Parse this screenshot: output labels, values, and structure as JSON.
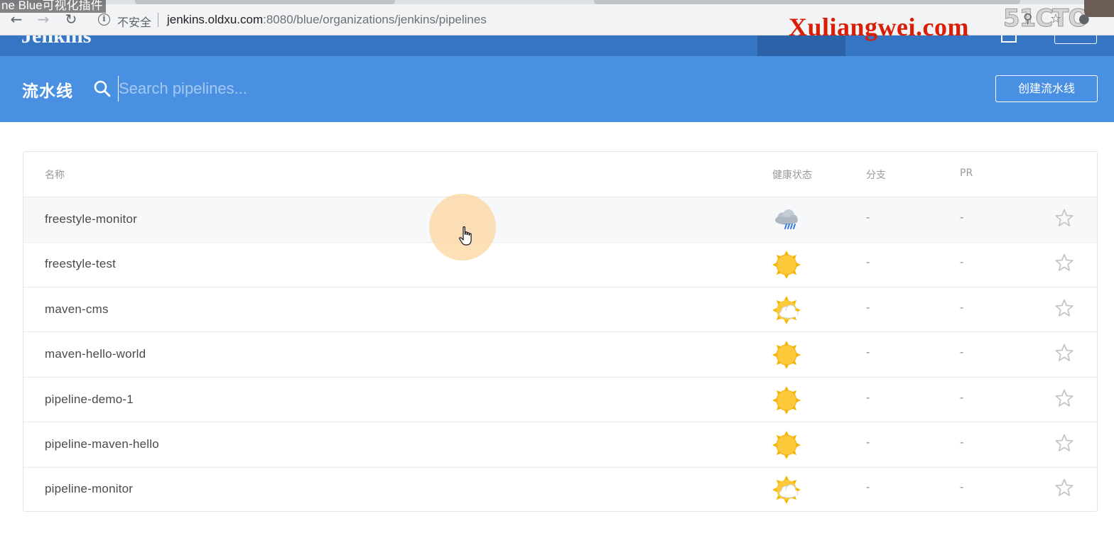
{
  "video": {
    "title_overlay": "ne Blue可视化插件"
  },
  "browser": {
    "back_icon": "arrow-back-icon",
    "forward_icon": "arrow-forward-icon",
    "reload_icon": "reload-icon",
    "security_label": "不安全",
    "url_host": "jenkins.oldxu.com",
    "url_rest": ":8080/blue/organizations/jenkins/pipelines"
  },
  "watermark": {
    "text": "Xuliangwei.com",
    "brand": "51CTO",
    "color": "#d81e06"
  },
  "jenkins": {
    "logo": "Jenkins"
  },
  "pipelines_bar": {
    "title": "流水线",
    "search_placeholder": "Search pipelines...",
    "create_button": "创建流水线",
    "accent": "#4a90e2"
  },
  "table": {
    "headers": {
      "name": "名称",
      "health": "健康状态",
      "branches": "分支",
      "pr": "PR"
    },
    "rows": [
      {
        "name": "freestyle-monitor",
        "health": "rain",
        "branches": "-",
        "pr": "-"
      },
      {
        "name": "freestyle-test",
        "health": "sunny",
        "branches": "-",
        "pr": "-"
      },
      {
        "name": "maven-cms",
        "health": "partly-cloudy",
        "branches": "-",
        "pr": "-"
      },
      {
        "name": "maven-hello-world",
        "health": "sunny",
        "branches": "-",
        "pr": "-"
      },
      {
        "name": "pipeline-demo-1",
        "health": "sunny",
        "branches": "-",
        "pr": "-"
      },
      {
        "name": "pipeline-maven-hello",
        "health": "sunny",
        "branches": "-",
        "pr": "-"
      },
      {
        "name": "pipeline-monitor",
        "health": "partly-cloudy",
        "branches": "-",
        "pr": "-"
      }
    ]
  }
}
